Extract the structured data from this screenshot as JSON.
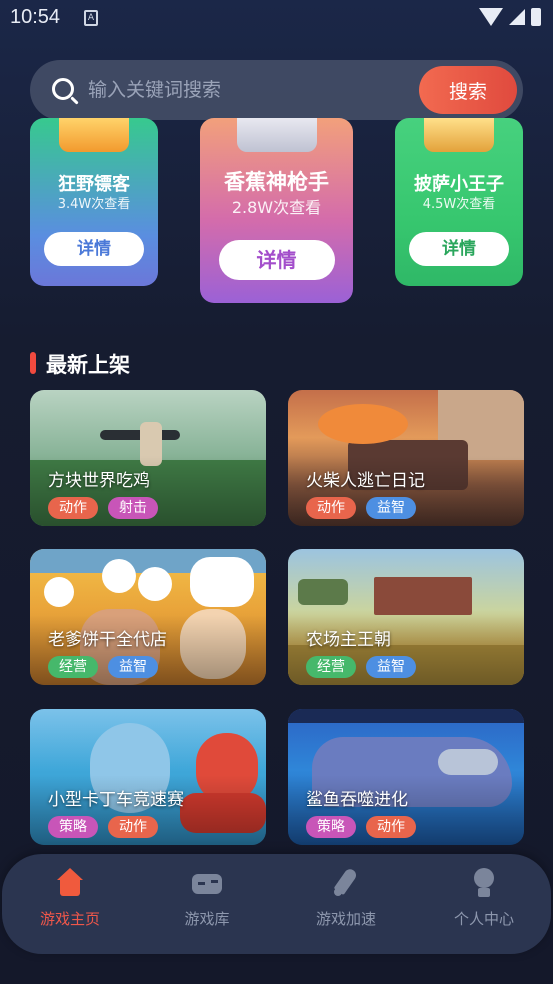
{
  "status_bar": {
    "time": "10:54",
    "notification_glyph": "A"
  },
  "search": {
    "placeholder": "输入关键词搜索",
    "button_label": "搜索"
  },
  "hot_games": [
    {
      "name": "狂野镖客",
      "views": "3.4W次查看",
      "detail_label": "详情"
    },
    {
      "name": "香蕉神枪手",
      "views": "2.8W次查看",
      "detail_label": "详情"
    },
    {
      "name": "披萨小王子",
      "views": "4.5W次查看",
      "detail_label": "详情"
    }
  ],
  "section": {
    "title": "最新上架"
  },
  "games": [
    {
      "title": "方块世界吃鸡",
      "tags": [
        "动作",
        "射击"
      ]
    },
    {
      "title": "火柴人逃亡日记",
      "tags": [
        "动作",
        "益智"
      ]
    },
    {
      "title": "老爹饼干全代店",
      "tags": [
        "经营",
        "益智"
      ]
    },
    {
      "title": "农场主王朝",
      "tags": [
        "经营",
        "益智"
      ]
    },
    {
      "title": "小型卡丁车竞速赛",
      "tags": [
        "策略",
        "动作"
      ]
    },
    {
      "title": "鲨鱼吞噬进化",
      "tags": [
        "策略",
        "动作"
      ]
    }
  ],
  "nav": [
    {
      "label": "游戏主页",
      "icon": "home-icon",
      "active": true
    },
    {
      "label": "游戏库",
      "icon": "gamepad-icon",
      "active": false
    },
    {
      "label": "游戏加速",
      "icon": "rocket-icon",
      "active": false
    },
    {
      "label": "个人中心",
      "icon": "user-icon",
      "active": false
    }
  ],
  "colors": {
    "accent": "#f0574a",
    "nav_bg": "#2b3550",
    "inactive": "#8d97ad"
  }
}
